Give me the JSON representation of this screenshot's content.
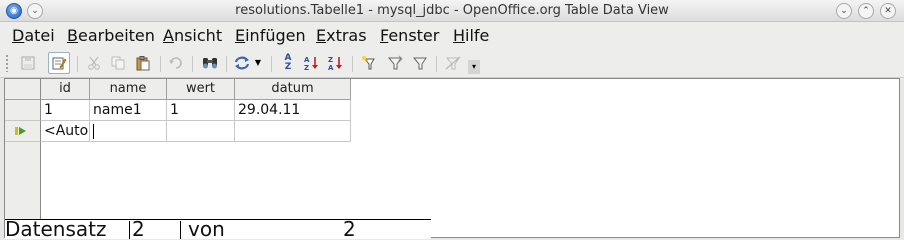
{
  "window": {
    "title": "resolutions.Tabelle1 - mysql_jdbc - OpenOffice.org Table Data View",
    "buttons": {
      "minimize": "⌄",
      "maximize": "⌃",
      "close": "✕",
      "pin": "⌄"
    }
  },
  "menu": [
    {
      "first": "D",
      "rest": "atei"
    },
    {
      "first": "B",
      "rest": "earbeiten"
    },
    {
      "first": "A",
      "rest": "nsicht"
    },
    {
      "first": "E",
      "rest": "infügen"
    },
    {
      "first": "E",
      "rest": "xtras"
    },
    {
      "first": "F",
      "rest": "enster"
    },
    {
      "first": "H",
      "rest": "ilfe"
    }
  ],
  "toolbar": {
    "icons": [
      "save-icon",
      "edit-data-icon",
      "cut-icon",
      "copy-icon",
      "paste-icon",
      "undo-icon",
      "find-icon",
      "refresh-icon",
      "sort-icon",
      "sort-ascending-icon",
      "sort-descending-icon",
      "autofilter-icon",
      "standard-filter-icon",
      "filter-icon",
      "remove-filter-icon"
    ],
    "sort_glyph": {
      "top": "A",
      "bottom": "Z"
    }
  },
  "grid": {
    "columns": [
      "id",
      "name",
      "wert",
      "datum"
    ],
    "rows": [
      [
        "1",
        "name1",
        "1",
        "29.04.11"
      ],
      [
        "<Auto",
        "",
        "",
        ""
      ]
    ]
  },
  "status": {
    "label": "Datensatz",
    "current": "2",
    "of_label": "von",
    "total": "2"
  }
}
